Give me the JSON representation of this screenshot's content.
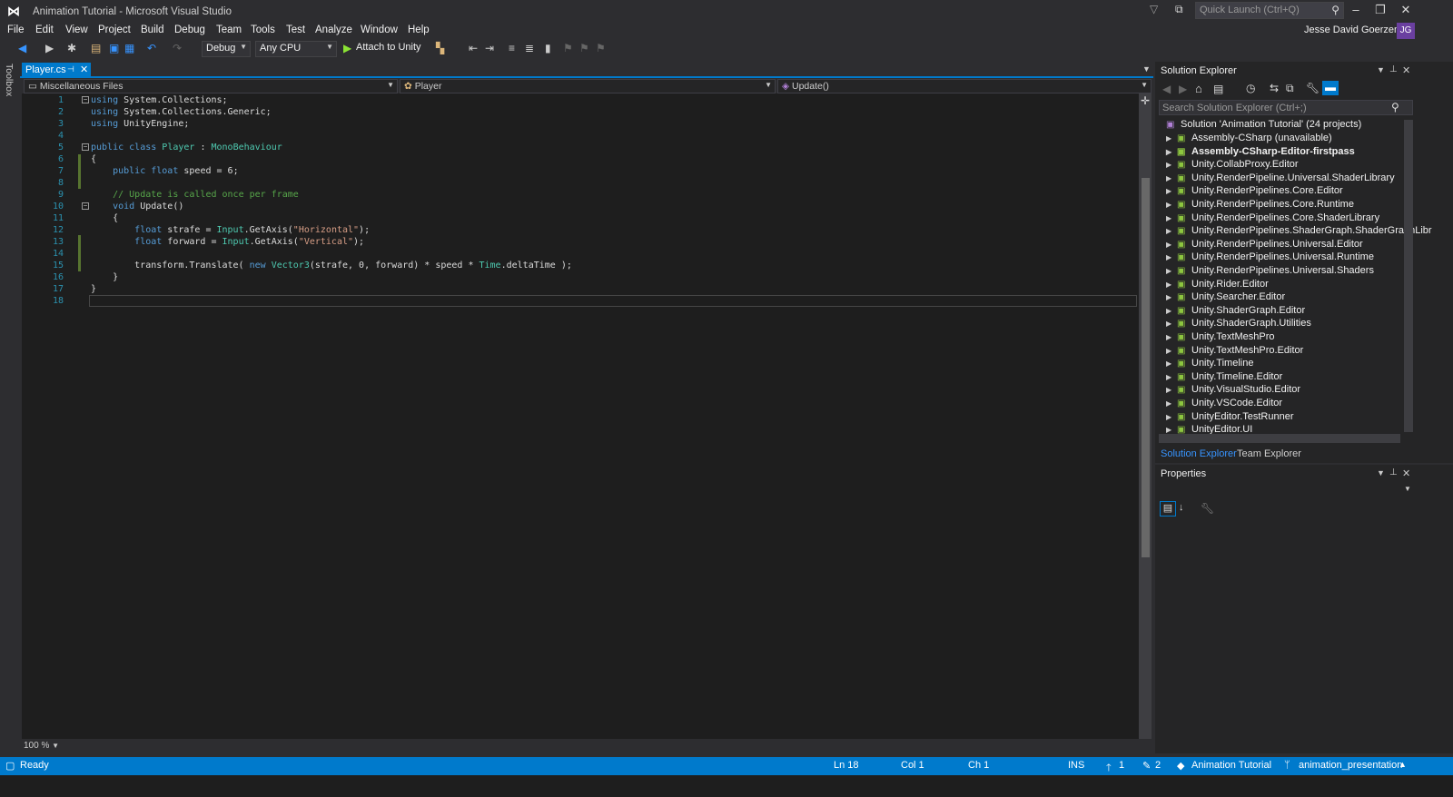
{
  "window": {
    "title": "Animation Tutorial - Microsoft Visual Studio",
    "quick_launch_placeholder": "Quick Launch (Ctrl+Q)"
  },
  "menu": [
    "File",
    "Edit",
    "View",
    "Project",
    "Build",
    "Debug",
    "Team",
    "Tools",
    "Test",
    "Analyze",
    "Window",
    "Help"
  ],
  "user": {
    "name": "Jesse David Goerzen",
    "initials": "JG"
  },
  "toolbar": {
    "config": "Debug",
    "platform": "Any CPU",
    "attach": "Attach to Unity"
  },
  "toolbox_label": "Toolbox",
  "document_tab": {
    "label": "Player.cs"
  },
  "navbar": {
    "project": "Miscellaneous Files",
    "class": "Player",
    "member": "Update()"
  },
  "code": {
    "lines": [
      "using System.Collections;",
      "using System.Collections.Generic;",
      "using UnityEngine;",
      "",
      "public class Player : MonoBehaviour",
      "{",
      "    public float speed = 6;",
      "",
      "    // Update is called once per frame",
      "    void Update()",
      "    {",
      "        float strafe = Input.GetAxis(\"Horizontal\");",
      "        float forward = Input.GetAxis(\"Vertical\");",
      "",
      "        transform.Translate( new Vector3(strafe, 0, forward) * speed * Time.deltaTime );",
      "    }",
      "}",
      ""
    ]
  },
  "zoom": "100 %",
  "solution_explorer": {
    "title": "Solution Explorer",
    "search_placeholder": "Search Solution Explorer (Ctrl+;)",
    "root": "Solution 'Animation Tutorial' (24 projects)",
    "projects": [
      "Assembly-CSharp (unavailable)",
      "Assembly-CSharp-Editor-firstpass",
      "Unity.CollabProxy.Editor",
      "Unity.RenderPipeline.Universal.ShaderLibrary",
      "Unity.RenderPipelines.Core.Editor",
      "Unity.RenderPipelines.Core.Runtime",
      "Unity.RenderPipelines.Core.ShaderLibrary",
      "Unity.RenderPipelines.ShaderGraph.ShaderGraphLibr",
      "Unity.RenderPipelines.Universal.Editor",
      "Unity.RenderPipelines.Universal.Runtime",
      "Unity.RenderPipelines.Universal.Shaders",
      "Unity.Rider.Editor",
      "Unity.Searcher.Editor",
      "Unity.ShaderGraph.Editor",
      "Unity.ShaderGraph.Utilities",
      "Unity.TextMeshPro",
      "Unity.TextMeshPro.Editor",
      "Unity.Timeline",
      "Unity.Timeline.Editor",
      "Unity.VisualStudio.Editor",
      "Unity.VSCode.Editor",
      "UnityEditor.TestRunner",
      "UnityEditor.UI"
    ],
    "tabs": [
      "Solution Explorer",
      "Team Explorer"
    ]
  },
  "properties": {
    "title": "Properties"
  },
  "status": {
    "ready": "Ready",
    "ln": "Ln 18",
    "col": "Col 1",
    "ch": "Ch 1",
    "ins": "INS",
    "up_count": "1",
    "edit_count": "2",
    "project": "Animation Tutorial",
    "branch": "animation_presentation"
  }
}
